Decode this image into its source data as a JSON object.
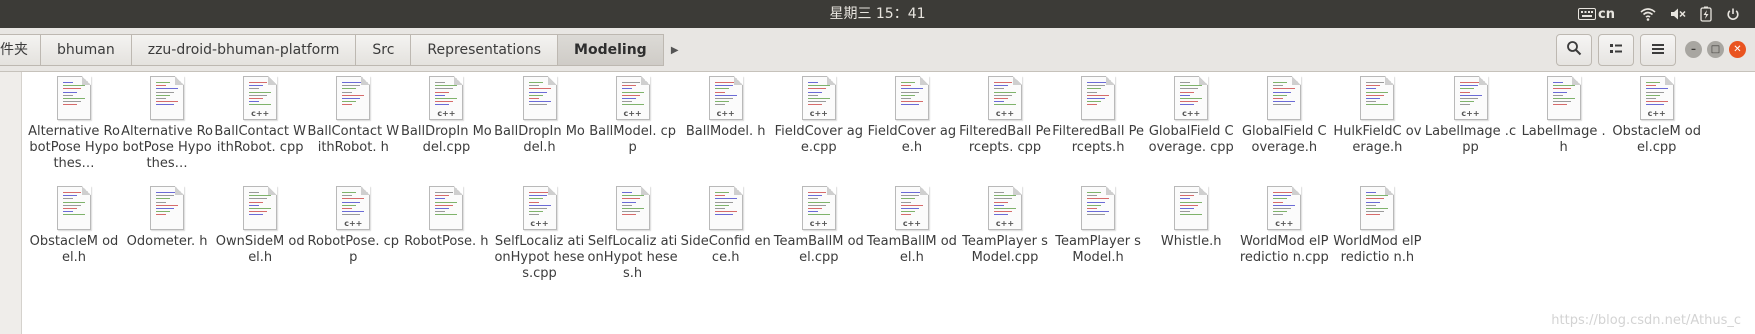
{
  "topbar": {
    "clock": "星期三 15：41",
    "keyboard_label": "cn"
  },
  "breadcrumbs": [
    {
      "label": "件夹"
    },
    {
      "label": "bhuman"
    },
    {
      "label": "zzu-droid-bhuman-platform"
    },
    {
      "label": "Src"
    },
    {
      "label": "Representations"
    },
    {
      "label": "Modeling",
      "current": true
    }
  ],
  "files": [
    {
      "name": "Alternative RobotPose Hypothes…",
      "type": "h"
    },
    {
      "name": "Alternative RobotPose Hypothes…",
      "type": "h"
    },
    {
      "name": "BallContact WithRobot. cpp",
      "type": "cpp"
    },
    {
      "name": "BallContact WithRobot. h",
      "type": "h"
    },
    {
      "name": "BallDropIn Model.cpp",
      "type": "cpp"
    },
    {
      "name": "BallDropIn Model.h",
      "type": "h"
    },
    {
      "name": "BallModel. cpp",
      "type": "cpp"
    },
    {
      "name": "BallModel. h",
      "type": "cpp"
    },
    {
      "name": "FieldCover age.cpp",
      "type": "cpp"
    },
    {
      "name": "FieldCover age.h",
      "type": "h"
    },
    {
      "name": "FilteredBall Percepts. cpp",
      "type": "cpp"
    },
    {
      "name": "FilteredBall Percepts.h",
      "type": "h"
    },
    {
      "name": "GlobalField Coverage. cpp",
      "type": "cpp"
    },
    {
      "name": "GlobalField Coverage.h",
      "type": "h"
    },
    {
      "name": "HulkFieldC overage.h",
      "type": "h"
    },
    {
      "name": "LabelImage .cpp",
      "type": "cpp"
    },
    {
      "name": "LabelImage .h",
      "type": "h"
    },
    {
      "name": "ObstacleM odel.cpp",
      "type": "cpp"
    },
    {
      "name": "ObstacleM odel.h",
      "type": "h"
    },
    {
      "name": "Odometer. h",
      "type": "h"
    },
    {
      "name": "OwnSideM odel.h",
      "type": "h"
    },
    {
      "name": "RobotPose. cpp",
      "type": "cpp"
    },
    {
      "name": "RobotPose. h",
      "type": "h"
    },
    {
      "name": "SelfLocaliz ationHypot heses.cpp",
      "type": "cpp"
    },
    {
      "name": "SelfLocaliz ationHypot heses.h",
      "type": "h"
    },
    {
      "name": "SideConfid ence.h",
      "type": "h"
    },
    {
      "name": "TeamBallM odel.cpp",
      "type": "cpp"
    },
    {
      "name": "TeamBallM odel.h",
      "type": "cpp"
    },
    {
      "name": "TeamPlayer sModel.cpp",
      "type": "cpp"
    },
    {
      "name": "TeamPlayer sModel.h",
      "type": "h"
    },
    {
      "name": "Whistle.h",
      "type": "h"
    },
    {
      "name": "WorldMod elPredictio n.cpp",
      "type": "cpp"
    },
    {
      "name": "WorldMod elPredictio n.h",
      "type": "h"
    }
  ],
  "watermark": "https://blog.csdn.net/Athus_c",
  "colors": {
    "panel": "#3c3b37",
    "close_button": "#e95420"
  }
}
